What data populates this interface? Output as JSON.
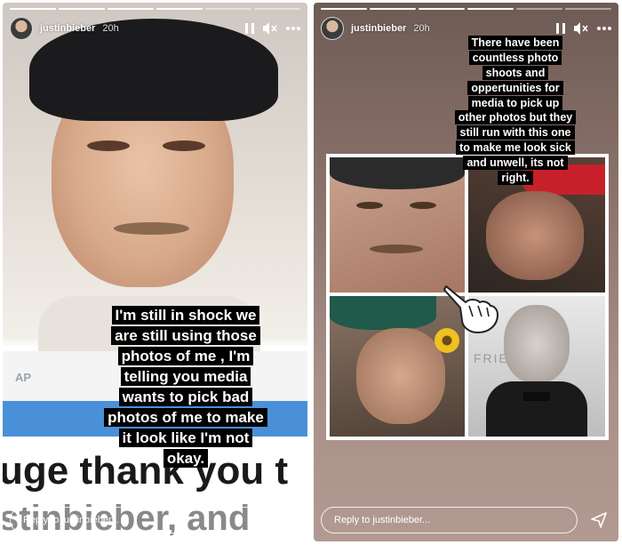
{
  "stories": [
    {
      "username": "justinbieber",
      "time": "20h",
      "progress_total": 6,
      "progress_done": 4,
      "caption_lines": [
        "I'm still in shock we",
        "are still using those",
        "photos of me , I'm",
        "telling you media",
        "wants to pick bad",
        "photos of me to make",
        "it look like I'm not",
        "okay."
      ],
      "background_text": {
        "label": "AP",
        "line1": "uge thank you t",
        "line2": "stinbieber, and"
      },
      "reply_placeholder": "Reply to justinbieber..."
    },
    {
      "username": "justinbieber",
      "time": "20h",
      "progress_total": 6,
      "progress_done": 4,
      "caption_lines": [
        "There have been",
        "countless photo",
        "shoots and",
        "oppertunities for",
        "media to pick up",
        "other photos but they",
        "still run with this one",
        "to make me look sick",
        "and unwell, its not",
        "right."
      ],
      "collage_text": "FRIEN",
      "pointer_icon": "pointing-hand",
      "reply_placeholder": "Reply to justinbieber..."
    }
  ],
  "icons": {
    "pause": "pause-icon",
    "mute": "speaker-muted-icon",
    "more": "more-horizontal-icon",
    "send": "send-icon"
  }
}
